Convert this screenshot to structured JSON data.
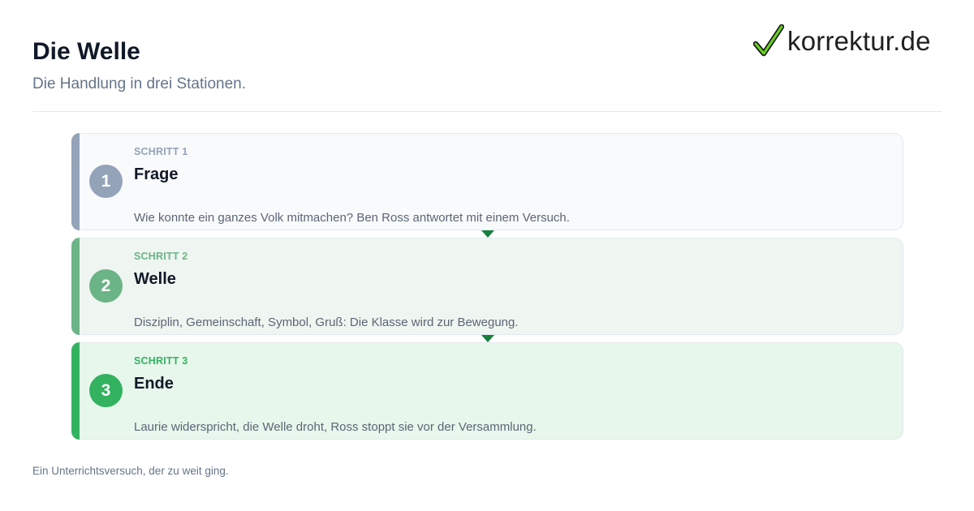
{
  "header": {
    "title": "Die Welle",
    "subtitle": "Die Handlung in drei Stationen."
  },
  "logo": {
    "icon": "checkmark-icon",
    "text": "korrektur.de",
    "icon_color": "#6bd41c"
  },
  "steps": [
    {
      "number": "1",
      "kicker": "SCHRITT 1",
      "title": "Frage",
      "description": "Wie konnte ein ganzes Volk mitmachen? Ben Ross antwortet mit einem Versuch.",
      "accent": "#94a3b8"
    },
    {
      "number": "2",
      "kicker": "SCHRITT 2",
      "title": "Welle",
      "description": "Disziplin, Gemeinschaft, Symbol, Gruß: Die Klasse wird zur Bewegung.",
      "accent": "#6bb487"
    },
    {
      "number": "3",
      "kicker": "SCHRITT 3",
      "title": "Ende",
      "description": "Laurie widerspricht, die Welle droht, Ross stoppt sie vor der Versammlung.",
      "accent": "#33b260"
    }
  ],
  "connector_color": "#16803c",
  "footer": {
    "note": "Ein Unterrichtsversuch, der zu weit ging."
  }
}
